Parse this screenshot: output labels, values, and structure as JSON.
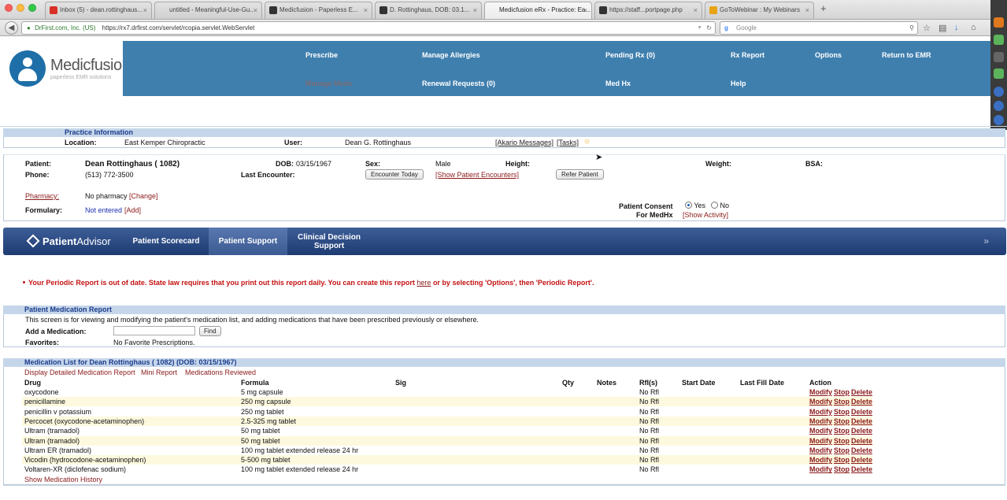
{
  "browser": {
    "tabs": [
      {
        "title": "Inbox (5) - dean.rottinghaus...",
        "favicon_color": "#d93025"
      },
      {
        "title": "untitled - Meaningful-Use-Gu...",
        "favicon_color": ""
      },
      {
        "title": "Medicfusion - Paperless E...",
        "favicon_color": "#333"
      },
      {
        "title": "D. Rottinghaus, DOB: 03.1...",
        "favicon_color": "#333"
      },
      {
        "title": "Medicfusion eRx - Practice: Ea...",
        "favicon_color": ""
      },
      {
        "title": "https://staff...portpage.php",
        "favicon_color": "#333"
      },
      {
        "title": "GoToWebinar : My Webinars",
        "favicon_color": "#e8a317"
      }
    ],
    "url_identity": "DrFirst.com, Inc. (US)",
    "url": "https://rx7.drfirst.com/servlet/rcopia.servlet.WebServlet",
    "search_placeholder": "Google",
    "new_tab_icon": "plus-icon"
  },
  "logo": {
    "brand": "Medicfusion",
    "tagline": "paperless EMR solutions"
  },
  "menu": {
    "prescribe": "Prescribe",
    "manage_allergies": "Manage Allergies",
    "pending_rx": "Pending Rx (0)",
    "rx_report": "Rx Report",
    "options": "Options",
    "return_emr": "Return to EMR",
    "manage_meds": "Manage Meds",
    "renewal_requests": "Renewal Requests (0)",
    "med_hx": "Med Hx",
    "help": "Help"
  },
  "practice": {
    "heading": "Practice Information",
    "location_label": "Location:",
    "location": "East Kemper Chiropractic",
    "user_label": "User:",
    "user": "Dean G. Rottinghaus",
    "akario": "[Akario Messages]",
    "tasks": "[Tasks]"
  },
  "patient": {
    "patient_label": "Patient:",
    "name": "Dean Rottinghaus ( 1082)",
    "dob_label": "DOB:",
    "dob": "03/15/1967",
    "sex_label": "Sex:",
    "sex": "Male",
    "height_label": "Height:",
    "weight_label": "Weight:",
    "bsa_label": "BSA:",
    "phone_label": "Phone:",
    "phone": "(513) 772-3500",
    "last_enc_label": "Last Encounter:",
    "encounter_today": "Encounter Today",
    "show_encounters": "[Show Patient Encounters]",
    "refer_patient": "Refer Patient",
    "pharmacy_label": "Pharmacy:",
    "pharmacy_value": "No pharmacy",
    "pharmacy_change": "[Change]",
    "formulary_label": "Formulary:",
    "formulary_value": "Not entered",
    "formulary_add": "[Add]",
    "consent_label_1": "Patient Consent",
    "consent_label_2": "For MedHx",
    "consent_yes": "Yes",
    "consent_no": "No",
    "consent_selected": "Yes",
    "show_activity": "[Show Activity]"
  },
  "patient_advisor": {
    "logo_text_1": "Patient",
    "logo_text_2": "Advisor",
    "tabs": [
      "Patient Scorecard",
      "Patient Support",
      "Clinical Decision Support"
    ],
    "selected_tab": "Patient Support"
  },
  "alert": {
    "before": "Your Periodic Report is out of date. State law requires that you print out this report daily. You can create this report ",
    "link": "here",
    "after": " or by selecting 'Options', then 'Periodic Report'."
  },
  "med_report": {
    "heading": "Patient Medication Report",
    "description": "This screen is for viewing and modifying the patient's medication list, and adding medications that have been prescribed previously or elsewhere.",
    "add_label": "Add a Medication:",
    "add_value": "",
    "find_button": "Find",
    "favorites_label": "Favorites:",
    "favorites_value": "No Favorite Prescriptions."
  },
  "med_list": {
    "heading": "Medication List for Dean Rottinghaus ( 1082) (DOB: 03/15/1967)",
    "links": [
      "Display Detailed Medication Report",
      "Mini Report",
      "Medications Reviewed"
    ],
    "columns": [
      "Drug",
      "Formula",
      "Sig",
      "Qty",
      "Notes",
      "Rfl(s)",
      "Start Date",
      "Last Fill Date",
      "Action"
    ],
    "rows": [
      {
        "drug": "oxycodone",
        "formula": "5 mg capsule",
        "rfl": "No Rfl"
      },
      {
        "drug": "penicillamine",
        "formula": "250 mg capsule",
        "rfl": "No Rfl"
      },
      {
        "drug": "penicillin v potassium",
        "formula": "250 mg tablet",
        "rfl": "No Rfl"
      },
      {
        "drug": "Percocet (oxycodone-acetaminophen)",
        "formula": "2.5-325 mg tablet",
        "rfl": "No Rfl"
      },
      {
        "drug": "Ultram (tramadol)",
        "formula": "50 mg tablet",
        "rfl": "No Rfl"
      },
      {
        "drug": "Ultram (tramadol)",
        "formula": "50 mg tablet",
        "rfl": "No Rfl"
      },
      {
        "drug": "Ultram ER (tramadol)",
        "formula": "100 mg tablet extended release 24 hr",
        "rfl": "No Rfl"
      },
      {
        "drug": "Vicodin (hydrocodone-acetaminophen)",
        "formula": "5-500 mg tablet",
        "rfl": "No Rfl"
      },
      {
        "drug": "Voltaren-XR (diclofenac sodium)",
        "formula": "100 mg tablet extended release 24 hr",
        "rfl": "No Rfl"
      }
    ],
    "actions": [
      "Modify",
      "Stop",
      "Delete"
    ],
    "history_link": "Show Medication History"
  }
}
